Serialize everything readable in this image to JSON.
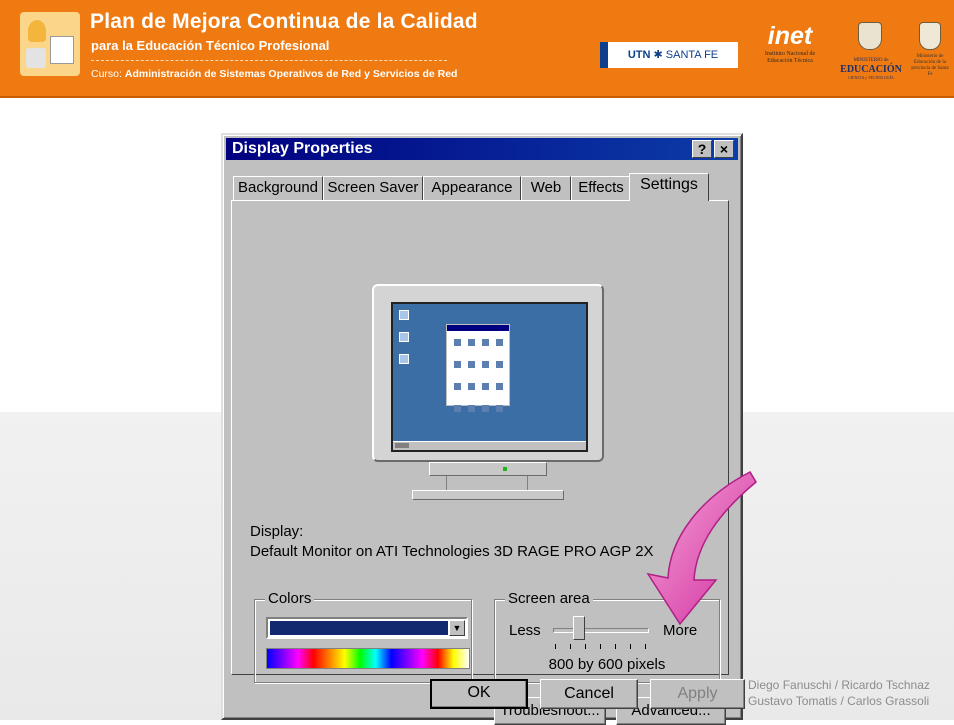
{
  "banner": {
    "title": "Plan de Mejora Continua de la Calidad",
    "subtitle": "para la Educación Técnico Profesional",
    "course_prefix": "Curso:",
    "course_name": "Administración de Sistemas Operativos de Red y Servicios de Red",
    "utn_label": "UTN",
    "utn_city": "SANTA FE",
    "inet_word": "inet",
    "inet_sub": "Instituto Nacional de Educación Técnica",
    "ministry_a": "MINISTERIO de",
    "ministry_b": "EDUCACIÓN",
    "ministry_c": "CIENCIA y TECNOLOGÍA",
    "santafe": "Ministerio de Educación de la provincia de Santa Fe"
  },
  "dialog": {
    "title": "Display Properties",
    "help_label": "?",
    "close_label": "×",
    "tabs": [
      {
        "label": "Background"
      },
      {
        "label": "Screen Saver"
      },
      {
        "label": "Appearance"
      },
      {
        "label": "Web"
      },
      {
        "label": "Effects"
      },
      {
        "label": "Settings",
        "active": true
      }
    ],
    "display_label": "Display:",
    "display_value": "Default Monitor on ATI Technologies 3D RAGE PRO AGP 2X",
    "colors": {
      "legend": "Colors",
      "selected_color": "#12296f"
    },
    "screen_area": {
      "legend": "Screen area",
      "less_label": "Less",
      "more_label": "More",
      "value": "800 by 600 pixels"
    },
    "buttons": {
      "troubleshoot": "Troubleshoot...",
      "advanced": "Advanced...",
      "ok": "OK",
      "cancel": "Cancel",
      "apply": "Apply"
    }
  },
  "footer": {
    "line1": "Diego Fanuschi / Ricardo Tschnaz",
    "line2": "Gustavo Tomatis / Carlos Grassoli"
  },
  "colors": {
    "banner_orange": "#f07a12",
    "titlebar_blue": "#000080",
    "dialog_gray": "#c0c0c0",
    "arrow_pink": "#e040b0",
    "desktop_teal": "#3a6ea5"
  }
}
